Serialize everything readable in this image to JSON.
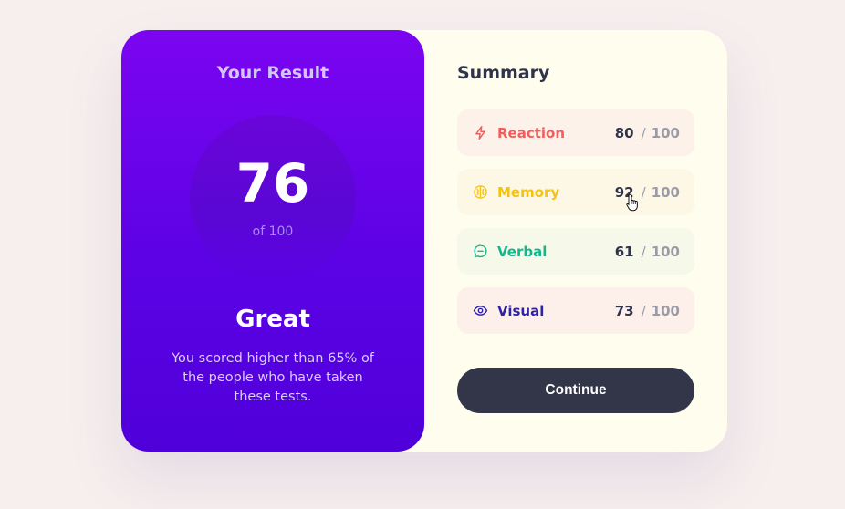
{
  "result": {
    "title": "Your Result",
    "score": "76",
    "score_max_text": "of 100",
    "rating": "Great",
    "description": "You scored higher than 65% of the people who have taken these tests."
  },
  "summary": {
    "title": "Summary",
    "categories": [
      {
        "label": "Reaction",
        "score": "80",
        "separator": "/",
        "max": "100",
        "icon": "lightning-icon",
        "color": "#f25d5d",
        "bg": "#fdf2ea"
      },
      {
        "label": "Memory",
        "score": "92",
        "separator": "/",
        "max": "100",
        "icon": "brain-icon",
        "color": "#f5c211",
        "bg": "#fdf8e6"
      },
      {
        "label": "Verbal",
        "score": "61",
        "separator": "/",
        "max": "100",
        "icon": "chat-icon",
        "color": "#14b78d",
        "bg": "#f6f8ea"
      },
      {
        "label": "Visual",
        "score": "73",
        "separator": "/",
        "max": "100",
        "icon": "eye-icon",
        "color": "#2f22a6",
        "bg": "#fdf0ea"
      }
    ],
    "continue_label": "Continue"
  },
  "colors": {
    "gradient_top": "#7b05f0",
    "gradient_bottom": "#4f00da",
    "card_bg": "#fffdee",
    "page_bg": "#f7eeee",
    "button_bg": "#333549"
  }
}
